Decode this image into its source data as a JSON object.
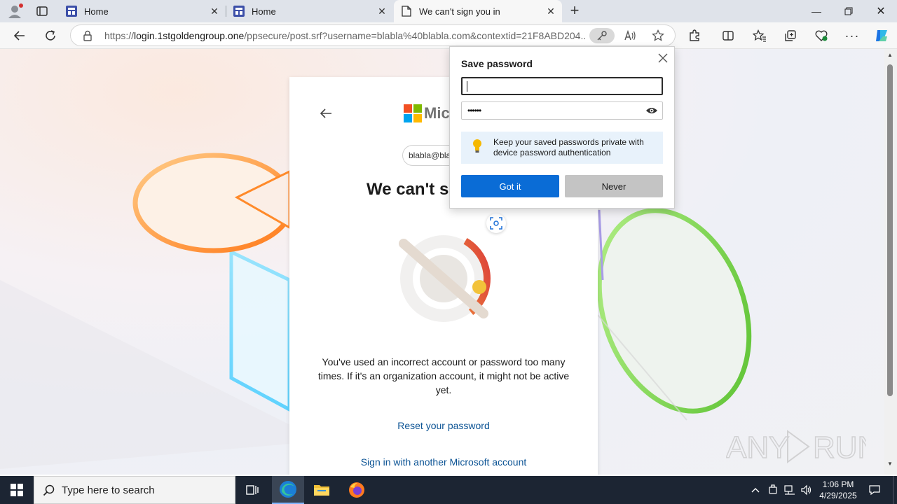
{
  "tabs": [
    {
      "title": "Home"
    },
    {
      "title": "Home"
    },
    {
      "title": "We can't sign you in"
    }
  ],
  "address_bar": {
    "url_prefix": "https://",
    "url_host": "login.1stgoldengroup.one",
    "url_rest": "/ppsecure/post.srf?username=blabla%40blabla.com&contextid=21F8ABD204..."
  },
  "signin": {
    "brand": "Micr",
    "email_chip": "blabla@bla",
    "heading": "We can't si",
    "message": "You've used an incorrect account or password too many times. If it's an organization account, it might not be active yet.",
    "reset_link": "Reset your password",
    "another_account_link": "Sign in with another Microsoft account"
  },
  "popup": {
    "title": "Save password",
    "username_value": "",
    "password_mask": "••••••",
    "info_text": "Keep your saved passwords private with device password authentication",
    "got_it_label": "Got it",
    "never_label": "Never"
  },
  "watermark": "ANY RUN",
  "taskbar": {
    "search_placeholder": "Type here to search",
    "time": "1:06 PM",
    "date": "4/29/2025"
  },
  "colors": {
    "accent": "#0a6cd6",
    "link": "#0b5394",
    "taskbar": "#1c2533"
  }
}
